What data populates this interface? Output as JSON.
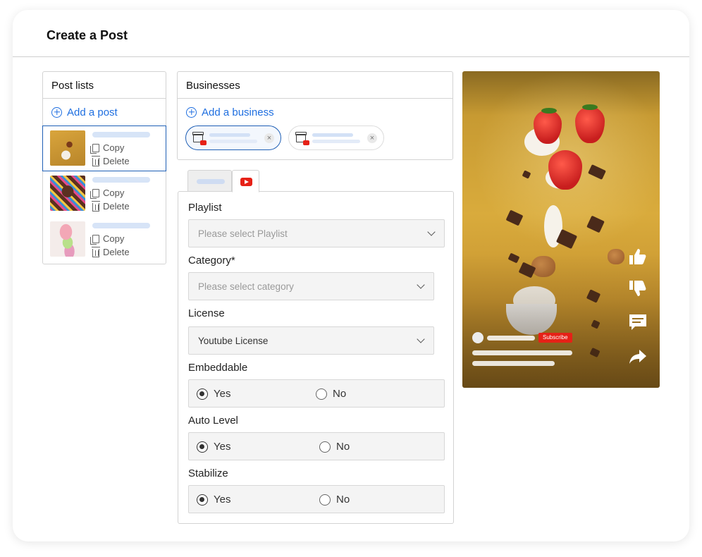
{
  "page": {
    "title": "Create a Post"
  },
  "post_lists": {
    "title": "Post lists",
    "add_label": "Add a post",
    "items": [
      {
        "copy": "Copy",
        "delete": "Delete",
        "selected": true
      },
      {
        "copy": "Copy",
        "delete": "Delete",
        "selected": false
      },
      {
        "copy": "Copy",
        "delete": "Delete",
        "selected": false
      }
    ]
  },
  "businesses": {
    "title": "Businesses",
    "add_label": "Add a business"
  },
  "form": {
    "playlist": {
      "label": "Playlist",
      "placeholder": "Please select Playlist"
    },
    "category": {
      "label": "Category*",
      "placeholder": "Please select category"
    },
    "license": {
      "label": "License",
      "value": "Youtube License"
    },
    "embeddable": {
      "label": "Embeddable",
      "yes": "Yes",
      "no": "No",
      "selected": "Yes"
    },
    "auto_level": {
      "label": "Auto Level",
      "yes": "Yes",
      "no": "No",
      "selected": "Yes"
    },
    "stabilize": {
      "label": "Stabilize",
      "yes": "Yes",
      "no": "No",
      "selected": "Yes"
    }
  },
  "preview": {
    "subscribe": "Subscribe"
  },
  "icons": {
    "add": "plus-circle-icon",
    "copy": "copy-icon",
    "delete": "trash-icon",
    "business": "store-icon",
    "youtube": "youtube-icon",
    "like": "thumbs-up-icon",
    "dislike": "thumbs-down-icon",
    "comment": "comment-icon",
    "share": "share-icon"
  },
  "colors": {
    "accent": "#1f6fe0",
    "youtube": "#e62117",
    "selected_border": "#1f5fb5"
  }
}
